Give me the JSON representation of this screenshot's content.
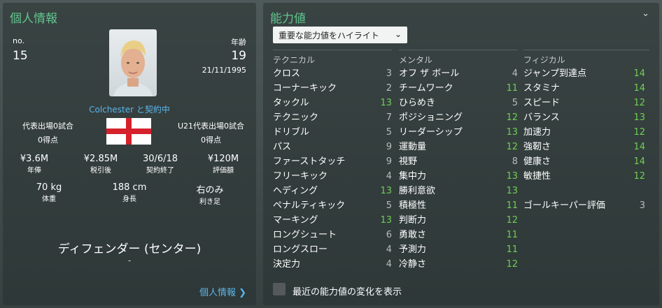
{
  "personal": {
    "title": "個人情報",
    "no_label": "no.",
    "no_value": "15",
    "age_label": "年齢",
    "age_value": "19",
    "dob": "21/11/1995",
    "contract_text": "Colchester と契約中",
    "intl_caps": "代表出場0試合",
    "intl_goals": "0得点",
    "u21_caps": "U21代表出場0試合",
    "u21_goals": "0得点",
    "stats": [
      {
        "value": "¥3.6M",
        "label": "年俸"
      },
      {
        "value": "¥2.85M",
        "label": "税引後"
      },
      {
        "value": "30/6/18",
        "label": "契約終了"
      },
      {
        "value": "¥120M",
        "label": "評価額"
      }
    ],
    "physical": [
      {
        "value": "70 kg",
        "label": "体重"
      },
      {
        "value": "188 cm",
        "label": "身長"
      },
      {
        "value": "右のみ",
        "label": "利き足"
      }
    ],
    "position": "ディフェンダー (センター)",
    "sub_position": "-",
    "footer_link": "個人情報 ❯"
  },
  "attributes": {
    "title": "能力値",
    "highlight_dropdown": "重要な能力値をハイライト",
    "chevron_icon": "chevron-down-icon",
    "collapse_icon": "chevron-down-icon",
    "technical_header": "テクニカル",
    "mental_header": "メンタル",
    "physical_header": "フィジカル",
    "technical": [
      {
        "name": "クロス",
        "value": "3"
      },
      {
        "name": "コーナーキック",
        "value": "2"
      },
      {
        "name": "タックル",
        "value": "13"
      },
      {
        "name": "テクニック",
        "value": "7"
      },
      {
        "name": "ドリブル",
        "value": "5"
      },
      {
        "name": "パス",
        "value": "9"
      },
      {
        "name": "ファーストタッチ",
        "value": "9"
      },
      {
        "name": "フリーキック",
        "value": "4"
      },
      {
        "name": "ヘディング",
        "value": "13"
      },
      {
        "name": "ペナルティキック",
        "value": "5"
      },
      {
        "name": "マーキング",
        "value": "13"
      },
      {
        "name": "ロングシュート",
        "value": "6"
      },
      {
        "name": "ロングスロー",
        "value": "4"
      },
      {
        "name": "決定力",
        "value": "4"
      }
    ],
    "mental": [
      {
        "name": "オフ ザ ボール",
        "value": "4"
      },
      {
        "name": "チームワーク",
        "value": "11"
      },
      {
        "name": "ひらめき",
        "value": "5"
      },
      {
        "name": "ポジショニング",
        "value": "12"
      },
      {
        "name": "リーダーシップ",
        "value": "13"
      },
      {
        "name": "運動量",
        "value": "12"
      },
      {
        "name": "視野",
        "value": "8"
      },
      {
        "name": "集中力",
        "value": "13"
      },
      {
        "name": "勝利意欲",
        "value": "13"
      },
      {
        "name": "積極性",
        "value": "11"
      },
      {
        "name": "判断力",
        "value": "12"
      },
      {
        "name": "勇敢さ",
        "value": "11"
      },
      {
        "name": "予測力",
        "value": "11"
      },
      {
        "name": "冷静さ",
        "value": "12"
      }
    ],
    "physical": [
      {
        "name": "ジャンプ到達点",
        "value": "14"
      },
      {
        "name": "スタミナ",
        "value": "14"
      },
      {
        "name": "スピード",
        "value": "12"
      },
      {
        "name": "バランス",
        "value": "13"
      },
      {
        "name": "加速力",
        "value": "12"
      },
      {
        "name": "強靭さ",
        "value": "14"
      },
      {
        "name": "健康さ",
        "value": "14"
      },
      {
        "name": "敏捷性",
        "value": "12"
      },
      {
        "name": "",
        "value": ""
      },
      {
        "name": "ゴールキーパー評価",
        "value": "3"
      }
    ],
    "show_changes_label": "最近の能力値の変化を表示"
  },
  "colors": {
    "title_green": "#62c58e",
    "value_green": "#6fcf52",
    "link_blue": "#5cb5e8"
  }
}
